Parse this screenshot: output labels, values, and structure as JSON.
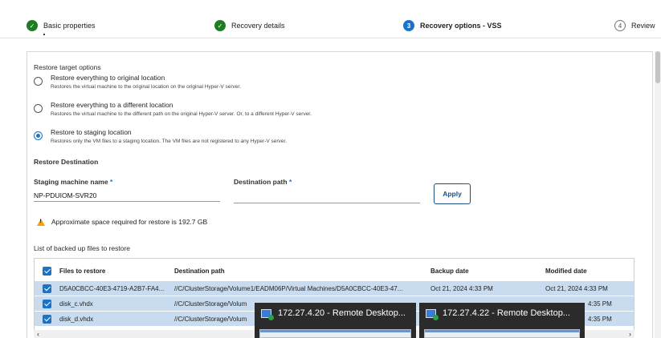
{
  "wizard": {
    "steps": [
      {
        "label": "Basic properties",
        "state": "done"
      },
      {
        "label": "Recovery details",
        "state": "done"
      },
      {
        "label": "Recovery options - VSS",
        "state": "active",
        "number": "3"
      },
      {
        "label": "Review",
        "state": "todo",
        "number": "4"
      }
    ]
  },
  "restore_target": {
    "title": "Restore target options",
    "options": [
      {
        "label": "Restore everything to original location",
        "desc": "Restores the virtual machine to the original location on the original Hyper-V server.",
        "selected": false
      },
      {
        "label": "Restore everything to a different location",
        "desc": "Restores the virtual machine to the different path on the original Hyper-V server. Or, to a different Hyper-V server.",
        "selected": false
      },
      {
        "label": "Restore to staging location",
        "desc": "Restores only the VM files to a staging location. The VM files are not registered to any Hyper-V server.",
        "selected": true
      }
    ]
  },
  "restore_destination": {
    "title": "Restore Destination",
    "staging_label": "Staging machine name",
    "staging_value": "NP-PDUIOM-SVR20",
    "dest_label": "Destination path",
    "dest_value": "",
    "required_mark": "*",
    "apply_label": "Apply"
  },
  "warning": {
    "text": "Approximate space required for restore is 192.7 GB",
    "color": "#f0a30a"
  },
  "files_table": {
    "title": "List of backed up files to restore",
    "columns": [
      "Files to restore",
      "Destination path",
      "Backup date",
      "Modified date"
    ],
    "rows": [
      {
        "file": "D5A0CBCC-40E3-4719-A2B7-FA4...",
        "dest": "//C/ClusterStorage/Volume1/EADM06P/Virtual Machines/D5A0CBCC-40E3-47...",
        "backup": "Oct 21, 2024 4:33 PM",
        "modified": "Oct 21, 2024 4:33 PM"
      },
      {
        "file": "disk_c.vhdx",
        "dest": "//C/ClusterStorage/Volum",
        "backup": "",
        "modified": "4:35 PM"
      },
      {
        "file": "disk_d.vhdx",
        "dest": "//C/ClusterStorage/Volum",
        "backup": "",
        "modified": "4:35 PM"
      }
    ]
  },
  "taskbar_previews": [
    {
      "title": "172.27.4.20 - Remote Desktop...",
      "icon": "remote-desktop-icon"
    },
    {
      "title": "172.27.4.22 - Remote Desktop...",
      "icon": "remote-desktop-icon"
    }
  ],
  "colors": {
    "accent": "#1a73c8",
    "done": "#1e7d22",
    "selected_row": "#c9dcef"
  }
}
